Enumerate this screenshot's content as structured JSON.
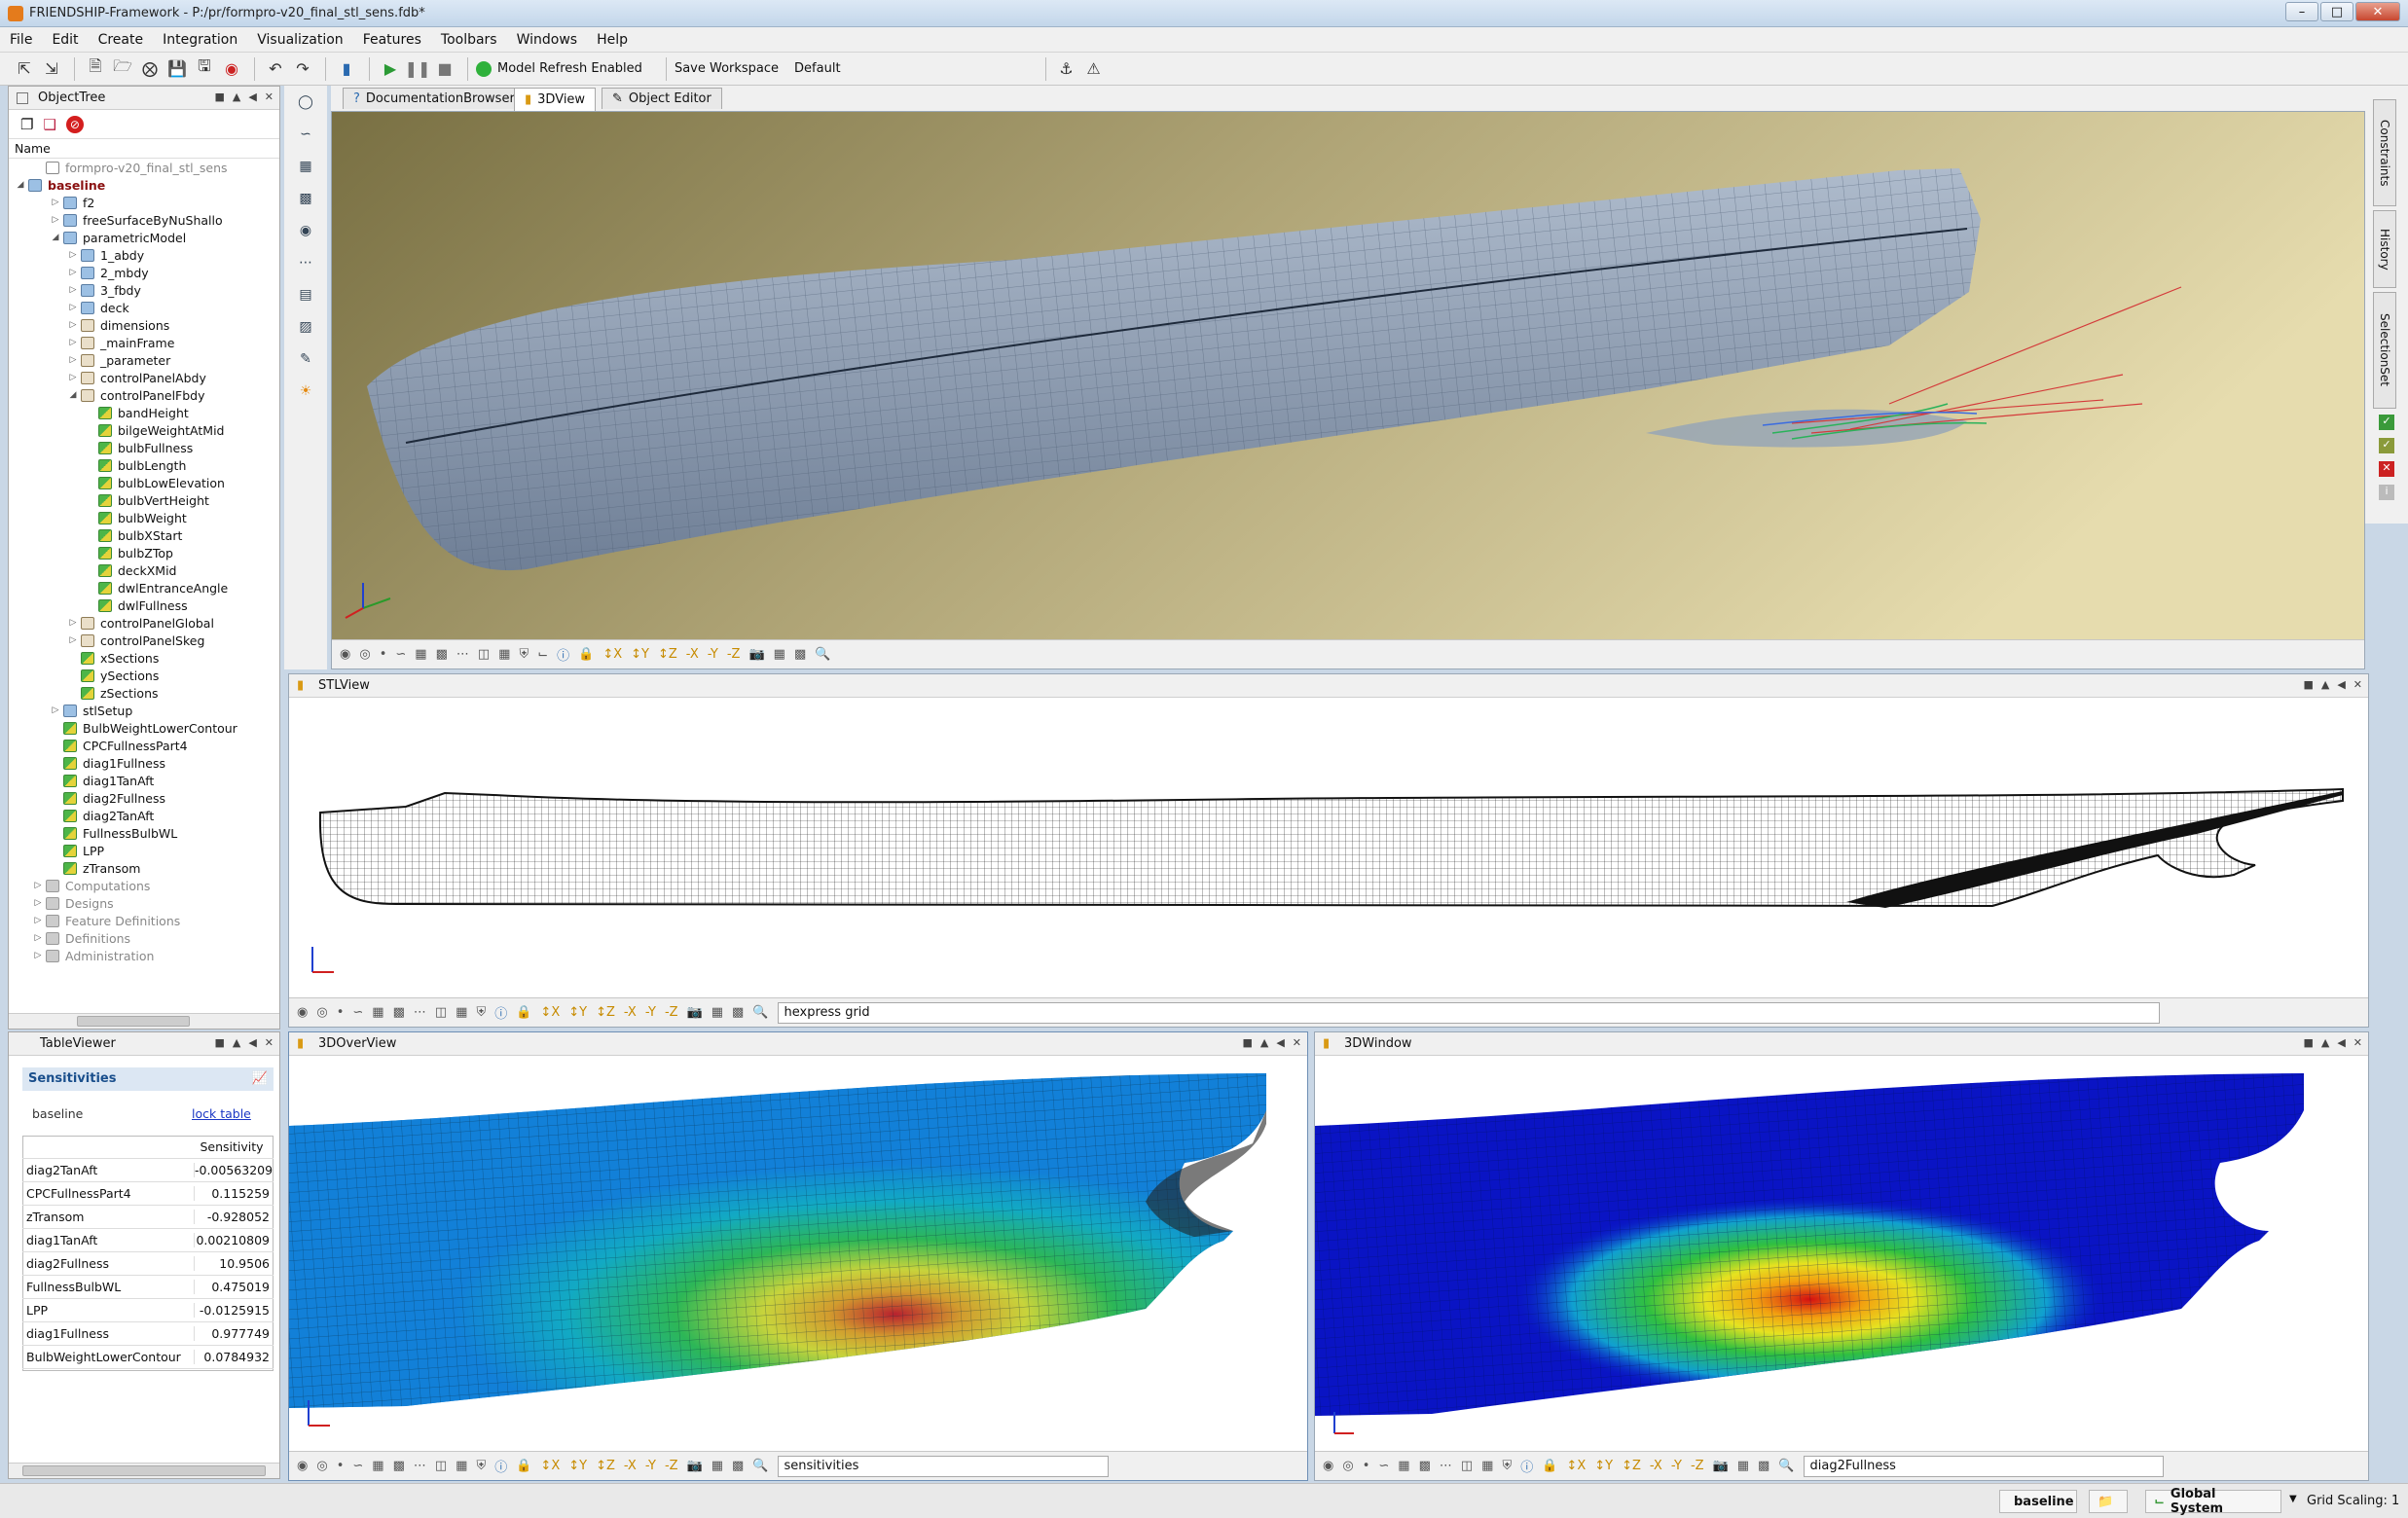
{
  "window": {
    "title": "FRIENDSHIP-Framework - P:/pr/formpro-v20_final_stl_sens.fdb*"
  },
  "menu": [
    "File",
    "Edit",
    "Create",
    "Integration",
    "Visualization",
    "Features",
    "Toolbars",
    "Windows",
    "Help"
  ],
  "toolbar": {
    "refresh_label": "Model Refresh Enabled",
    "save_workspace": "Save Workspace",
    "default_label": "Default"
  },
  "object_tree": {
    "title": "ObjectTree",
    "column": "Name",
    "rows": [
      {
        "label": "formpro-v20_final_stl_sens",
        "level": 1,
        "twisty": "",
        "icon": "file",
        "gray": true
      },
      {
        "label": "baseline",
        "level": 0,
        "twisty": "◢",
        "icon": "folder",
        "bold": true
      },
      {
        "label": "f2",
        "level": 2,
        "twisty": "▷",
        "icon": "folder"
      },
      {
        "label": "freeSurfaceByNuShallo",
        "level": 2,
        "twisty": "▷",
        "icon": "folder"
      },
      {
        "label": "parametricModel",
        "level": 2,
        "twisty": "◢",
        "icon": "folder"
      },
      {
        "label": "1_abdy",
        "level": 3,
        "twisty": "▷",
        "icon": "folder"
      },
      {
        "label": "2_mbdy",
        "level": 3,
        "twisty": "▷",
        "icon": "folder"
      },
      {
        "label": "3_fbdy",
        "level": 3,
        "twisty": "▷",
        "icon": "folder"
      },
      {
        "label": "deck",
        "level": 3,
        "twisty": "▷",
        "icon": "folder"
      },
      {
        "label": "dimensions",
        "level": 3,
        "twisty": "▷",
        "icon": "feat"
      },
      {
        "label": "_mainFrame",
        "level": 3,
        "twisty": "▷",
        "icon": "feat"
      },
      {
        "label": "_parameter",
        "level": 3,
        "twisty": "▷",
        "icon": "feat"
      },
      {
        "label": "controlPanelAbdy",
        "level": 3,
        "twisty": "▷",
        "icon": "feat"
      },
      {
        "label": "controlPanelFbdy",
        "level": 3,
        "twisty": "◢",
        "icon": "feat"
      },
      {
        "label": "bandHeight",
        "level": 4,
        "twisty": "",
        "icon": "param"
      },
      {
        "label": "bilgeWeightAtMid",
        "level": 4,
        "twisty": "",
        "icon": "param"
      },
      {
        "label": "bulbFullness",
        "level": 4,
        "twisty": "",
        "icon": "param"
      },
      {
        "label": "bulbLength",
        "level": 4,
        "twisty": "",
        "icon": "param"
      },
      {
        "label": "bulbLowElevation",
        "level": 4,
        "twisty": "",
        "icon": "param"
      },
      {
        "label": "bulbVertHeight",
        "level": 4,
        "twisty": "",
        "icon": "param"
      },
      {
        "label": "bulbWeight",
        "level": 4,
        "twisty": "",
        "icon": "param"
      },
      {
        "label": "bulbXStart",
        "level": 4,
        "twisty": "",
        "icon": "param"
      },
      {
        "label": "bulbZTop",
        "level": 4,
        "twisty": "",
        "icon": "param"
      },
      {
        "label": "deckXMid",
        "level": 4,
        "twisty": "",
        "icon": "param"
      },
      {
        "label": "dwlEntranceAngle",
        "level": 4,
        "twisty": "",
        "icon": "param"
      },
      {
        "label": "dwlFullness",
        "level": 4,
        "twisty": "",
        "icon": "param"
      },
      {
        "label": "controlPanelGlobal",
        "level": 3,
        "twisty": "▷",
        "icon": "feat"
      },
      {
        "label": "controlPanelSkeg",
        "level": 3,
        "twisty": "▷",
        "icon": "feat"
      },
      {
        "label": "xSections",
        "level": 3,
        "twisty": "",
        "icon": "param"
      },
      {
        "label": "ySections",
        "level": 3,
        "twisty": "",
        "icon": "param"
      },
      {
        "label": "zSections",
        "level": 3,
        "twisty": "",
        "icon": "param"
      },
      {
        "label": "stlSetup",
        "level": 2,
        "twisty": "▷",
        "icon": "folder"
      },
      {
        "label": "BulbWeightLowerContour",
        "level": 2,
        "twisty": "",
        "icon": "param"
      },
      {
        "label": "CPCFullnessPart4",
        "level": 2,
        "twisty": "",
        "icon": "param"
      },
      {
        "label": "diag1Fullness",
        "level": 2,
        "twisty": "",
        "icon": "param"
      },
      {
        "label": "diag1TanAft",
        "level": 2,
        "twisty": "",
        "icon": "param"
      },
      {
        "label": "diag2Fullness",
        "level": 2,
        "twisty": "",
        "icon": "param"
      },
      {
        "label": "diag2TanAft",
        "level": 2,
        "twisty": "",
        "icon": "param"
      },
      {
        "label": "FullnessBulbWL",
        "level": 2,
        "twisty": "",
        "icon": "param"
      },
      {
        "label": "LPP",
        "level": 2,
        "twisty": "",
        "icon": "param"
      },
      {
        "label": "zTransom",
        "level": 2,
        "twisty": "",
        "icon": "param"
      },
      {
        "label": "Computations",
        "level": 1,
        "twisty": "▷",
        "icon": "gray",
        "gray": true
      },
      {
        "label": "Designs",
        "level": 1,
        "twisty": "▷",
        "icon": "gray",
        "gray": true
      },
      {
        "label": "Feature Definitions",
        "level": 1,
        "twisty": "▷",
        "icon": "gray",
        "gray": true
      },
      {
        "label": "Definitions",
        "level": 1,
        "twisty": "▷",
        "icon": "gray",
        "gray": true
      },
      {
        "label": "Administration",
        "level": 1,
        "twisty": "▷",
        "icon": "gray",
        "gray": true
      }
    ]
  },
  "table_viewer": {
    "title": "TableViewer",
    "heading": "Sensitivities",
    "design": "baseline",
    "lock_link": "lock table",
    "column": "Sensitivity",
    "rows": [
      {
        "name": "diag2TanAft",
        "value": "-0.00563209"
      },
      {
        "name": "CPCFullnessPart4",
        "value": "0.115259"
      },
      {
        "name": "zTransom",
        "value": "-0.928052"
      },
      {
        "name": "diag1TanAft",
        "value": "0.00210809"
      },
      {
        "name": "diag2Fullness",
        "value": "10.9506"
      },
      {
        "name": "FullnessBulbWL",
        "value": "0.475019"
      },
      {
        "name": "LPP",
        "value": "-0.0125915"
      },
      {
        "name": "diag1Fullness",
        "value": "0.977749"
      },
      {
        "name": "BulbWeightLowerContour",
        "value": "0.0784932"
      }
    ]
  },
  "tabs": [
    "DocumentationBrowser",
    "3DView",
    "Object Editor"
  ],
  "right_tabs": [
    "Constraints",
    "History",
    "SelectionSet"
  ],
  "views": {
    "stl": {
      "title": "STLView",
      "field": "hexpress grid"
    },
    "overview": {
      "title": "3DOverView",
      "field": "sensitivities"
    },
    "window3d": {
      "title": "3DWindow",
      "field": "diag2Fullness"
    }
  },
  "statusbar": {
    "design": "baseline",
    "system": "Global System",
    "grid": "Grid Scaling: 1"
  },
  "colors": {
    "accent": "#3a78c4",
    "hull": "#8a9cb2",
    "sens_low": "#0010c0",
    "sens_high": "#e00000"
  }
}
